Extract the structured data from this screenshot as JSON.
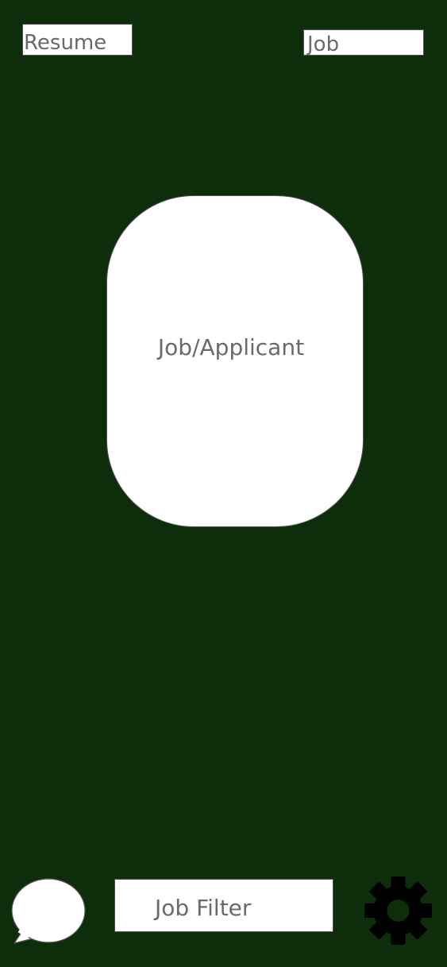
{
  "header": {
    "resume_label": "Resume",
    "job_label": "Job"
  },
  "card": {
    "label": "Job/Applicant"
  },
  "bottom_bar": {
    "chat_icon": "speech-bubble-icon",
    "filter_label": "Job Filter",
    "settings_icon": "gear-icon"
  },
  "colors": {
    "background": "#0e2e0b",
    "surface": "#ffffff",
    "text": "#6a6a6a",
    "border": "#555555",
    "gear": "#000000"
  }
}
